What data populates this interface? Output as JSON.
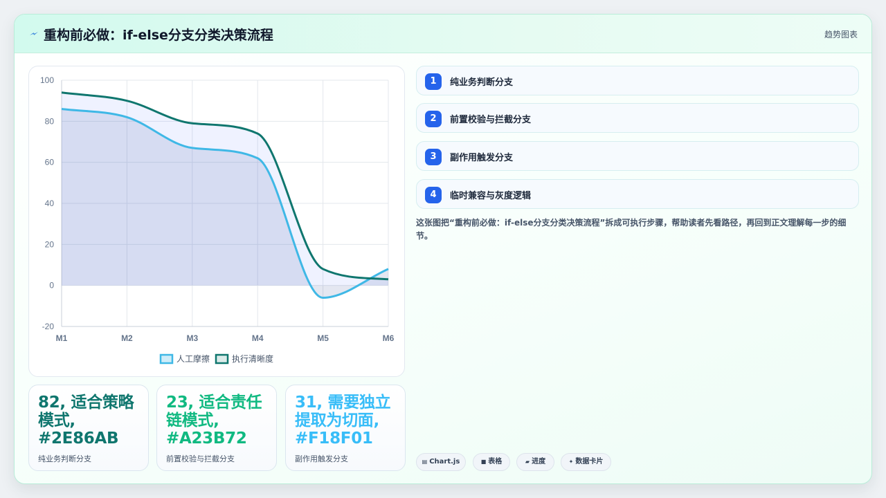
{
  "header": {
    "title": "重构前必做：if-else分支分类决策流程",
    "tag": "趋势图表",
    "icon": "bolt-icon"
  },
  "steps": [
    {
      "num": "1",
      "label": "纯业务判断分支"
    },
    {
      "num": "2",
      "label": "前置校验与拦截分支"
    },
    {
      "num": "3",
      "label": "副作用触发分支"
    },
    {
      "num": "4",
      "label": "临时兼容与灰度逻辑"
    }
  ],
  "description": "这张图把“重构前必做：if-else分支分类决策流程”拆成可执行步骤，帮助读者先看路径，再回到正文理解每一步的细节。",
  "stats": [
    {
      "value": "82, 适合策略模式, #2E86AB",
      "label": "纯业务判断分支",
      "color": "#0f766e"
    },
    {
      "value": "23, 适合责任链模式, #A23B72",
      "label": "前置校验与拦截分支",
      "color": "#10b981"
    },
    {
      "value": "31, 需要独立提取为切面, #F18F01",
      "label": "副作用触发分支",
      "color": "#38bdf8"
    }
  ],
  "chips": [
    {
      "icon": "chart-icon",
      "glyph": "▤",
      "label": "Chart.js"
    },
    {
      "icon": "table-icon",
      "glyph": "■",
      "label": "表格"
    },
    {
      "icon": "progress-icon",
      "glyph": "▰",
      "label": "进度"
    },
    {
      "icon": "sparkle-icon",
      "glyph": "✦",
      "label": "数据卡片"
    }
  ],
  "chart_data": {
    "type": "line",
    "categories": [
      "M1",
      "M2",
      "M3",
      "M4",
      "M5",
      "M6"
    ],
    "ylim": [
      -20,
      100
    ],
    "yticks": [
      100,
      80,
      60,
      40,
      20,
      0,
      -20
    ],
    "grid": true,
    "legend_position": "bottom",
    "series": [
      {
        "name": "人工摩擦",
        "values": [
          86,
          82,
          67,
          62,
          -6,
          8
        ],
        "color": "#3fb8e6",
        "fill": true
      },
      {
        "name": "执行清晰度",
        "values": [
          94,
          90,
          79,
          74,
          8,
          3
        ],
        "color": "#0f766e",
        "fill": true
      }
    ]
  }
}
